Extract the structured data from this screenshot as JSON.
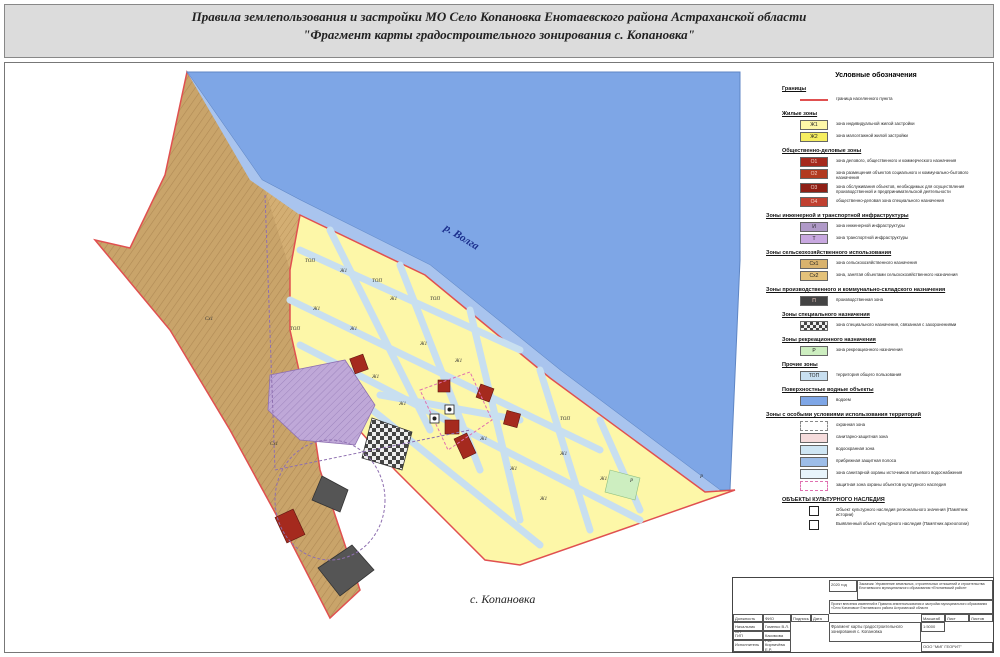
{
  "header": {
    "title": "Правила землепользования и застройки МО Село Копановка Енотаевского района Астраханской области",
    "subtitle": "\"Фрагмент карты градостроительного зонирования с. Копановка\""
  },
  "map": {
    "river_label": "р. Волга",
    "village_label": "с. Копановка",
    "zone_labels": [
      "Ж1",
      "Ж1",
      "Ж1",
      "Ж1",
      "Ж1",
      "Ж1",
      "Ж1",
      "Ж1",
      "Ж1",
      "Ж1",
      "Ж1",
      "Ж1",
      "Ж1",
      "ТОП",
      "ТОП",
      "ТОП",
      "ТОП",
      "ТОП",
      "Сх1",
      "Сх1",
      "Р",
      "Р"
    ],
    "colors": {
      "river": "#7ea6e6",
      "agri": "#c9a46a",
      "residential": "#fdf7a8",
      "road": "#c8dff0",
      "public": "#a52a1e",
      "transport": "#b9a3d6",
      "special": "#555555",
      "boundary": "#e05050"
    }
  },
  "legend": {
    "title": "Условные обозначения",
    "sections": [
      {
        "title": "Границы",
        "items": [
          {
            "code": "",
            "text": "граница населенного пункта",
            "color": "#e05050",
            "kind": "line"
          }
        ]
      },
      {
        "title": "Жилые зоны",
        "items": [
          {
            "code": "Ж1",
            "text": "зона индивидуальной жилой застройки",
            "color": "#fdf7a8"
          },
          {
            "code": "Ж2",
            "text": "зона малоэтажной жилой застройки",
            "color": "#f6ee60"
          }
        ]
      },
      {
        "title": "Общественно-деловые зоны",
        "items": [
          {
            "code": "О1",
            "text": "зона делового, общественного и коммерческого назначения",
            "color": "#a52a1e"
          },
          {
            "code": "О2",
            "text": "зона размещения объектов социального и коммунально-бытового назначения",
            "color": "#b23a20"
          },
          {
            "code": "О3",
            "text": "зона обслуживания объектов, необходимых для осуществления производственной и предпринимательской деятельности",
            "color": "#8e1f15"
          },
          {
            "code": "О4",
            "text": "общественно-деловая зона специального назначения",
            "color": "#c04030"
          }
        ]
      },
      {
        "title": "Зоны инженерной и транспортной инфраструктуры",
        "items": [
          {
            "code": "И",
            "text": "зона инженерной инфраструктуры",
            "color": "#b09ac8"
          },
          {
            "code": "Т",
            "text": "зона транспортной инфраструктуры",
            "color": "#c8a8e0"
          }
        ]
      },
      {
        "title": "Зоны сельскохозяйственного использования",
        "items": [
          {
            "code": "Сх1",
            "text": "зона сельскохозяйственного назначения",
            "color": "#d9b36e"
          },
          {
            "code": "Сх2",
            "text": "зона, занятая объектами сельскохозяйственного назначения",
            "color": "#e4c27a"
          }
        ]
      },
      {
        "title": "Зоны производственного и коммунально-складского назначения",
        "items": [
          {
            "code": "П",
            "text": "производственная зона",
            "color": "#444444"
          }
        ]
      },
      {
        "title": "Зоны специального назначения",
        "items": [
          {
            "code": "",
            "text": "зона специального назначения, связанная с захоронениями",
            "color": "#777777",
            "kind": "checker"
          }
        ]
      },
      {
        "title": "Зоны рекреационного назначения",
        "items": [
          {
            "code": "Р",
            "text": "зона рекреационного назначения",
            "color": "#cdeec0"
          }
        ]
      },
      {
        "title": "Прочие зоны",
        "items": [
          {
            "code": "ТОП",
            "text": "территория общего пользования",
            "color": "#c8dff0"
          }
        ]
      },
      {
        "title": "Поверхностные водные объекты",
        "items": [
          {
            "code": "",
            "text": "водоем",
            "color": "#7ea6e6"
          }
        ]
      },
      {
        "title": "Зоны с особыми условиями использования территорий",
        "items": [
          {
            "code": "",
            "text": "охранная зона",
            "color": "#ffffff",
            "kind": "dash"
          },
          {
            "code": "",
            "text": "санитарно-защитная зона",
            "color": "#f6dcdc"
          },
          {
            "code": "",
            "text": "водоохранная зона",
            "color": "#cfe6f4"
          },
          {
            "code": "",
            "text": "прибрежная защитная полоса",
            "color": "#9dbde8"
          },
          {
            "code": "",
            "text": "зона санитарной охраны источников питьевого водоснабжения",
            "color": "#e8f4fb"
          },
          {
            "code": "",
            "text": "защитная зона охраны объектов культурного наследия",
            "color": "#ffffff",
            "kind": "pinkdash"
          }
        ]
      },
      {
        "title": "ОБЪЕКТЫ КУЛЬТУРНОГО НАСЛЕДИЯ",
        "items": [
          {
            "code": "",
            "text": "Объект культурного наследия регионального значения (Памятник истории)",
            "color": "#ffffff",
            "kind": "icon"
          },
          {
            "code": "",
            "text": "Выявленный объект культурного наследия (Памятник археологии)",
            "color": "#ffffff",
            "kind": "icon"
          }
        ]
      }
    ]
  },
  "stamp": {
    "year": "2020 год",
    "customer": "Заказчик: Управление земельных, строительных отношений и строительства Енотаевского муниципального образования «Енотаевский район»",
    "project": "Проект внесения изменений в Правила землепользования и застройки муниципального образования «Село Копановка» Енотаевского района Астраханской области",
    "sheet_title": "Фрагмент карты градостроительного зонирования с. Копановка",
    "scale": "1:5000",
    "org": "ООО \"МИГ ГЕОРИТ\"",
    "roles": [
      "Должность",
      "Начальник ОП",
      "ГИП",
      "Исполнитель"
    ],
    "names": [
      "ФИО",
      "Гоменко В.Л.",
      "Касимова Р.А.",
      "Кирпичёва Е.Р."
    ],
    "col_heads": [
      "Подпись",
      "Дата"
    ],
    "stage_heads": [
      "Масштаб",
      "Лист",
      "Листов"
    ]
  }
}
